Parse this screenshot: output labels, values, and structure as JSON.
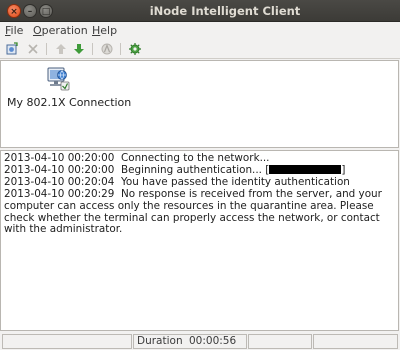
{
  "window": {
    "title": "iNode Intelligent Client",
    "controls": {
      "close": "×",
      "minimize": "–",
      "maximize": "□"
    }
  },
  "menubar": {
    "items": [
      {
        "mnemonic": "F",
        "rest": "ile"
      },
      {
        "mnemonic": "O",
        "rest": "peration"
      },
      {
        "mnemonic": "H",
        "rest": "elp"
      }
    ]
  },
  "toolbar": {
    "icons": [
      "new-connection-icon",
      "delete-icon",
      "move-up-icon",
      "move-down-icon",
      "properties-icon",
      "settings-gear-icon"
    ]
  },
  "connections": [
    {
      "label": "My 802.1X Connection",
      "icon": "network-connection-icon"
    }
  ],
  "log": {
    "lines": [
      {
        "text": "2013-04-10 00:20:00  Connecting to the network..."
      },
      {
        "text": "2013-04-10 00:20:00  Beginning authentication... [",
        "suffix": "]"
      },
      {
        "text": "2013-04-10 00:20:04  You have passed the identity authentication"
      },
      {
        "text": "2013-04-10 00:20:29  No response is received from the server, and your computer can access only the resources in the quarantine area. Please check whether the terminal can properly access the network, or contact with the administrator."
      }
    ]
  },
  "statusbar": {
    "duration_label": "Duration",
    "duration_value": "00:00:56"
  },
  "colors": {
    "titlebar": "#3c3b37",
    "close_button": "#df4a16",
    "window_bg": "#f2f1f0",
    "pane_bg": "#ffffff"
  }
}
